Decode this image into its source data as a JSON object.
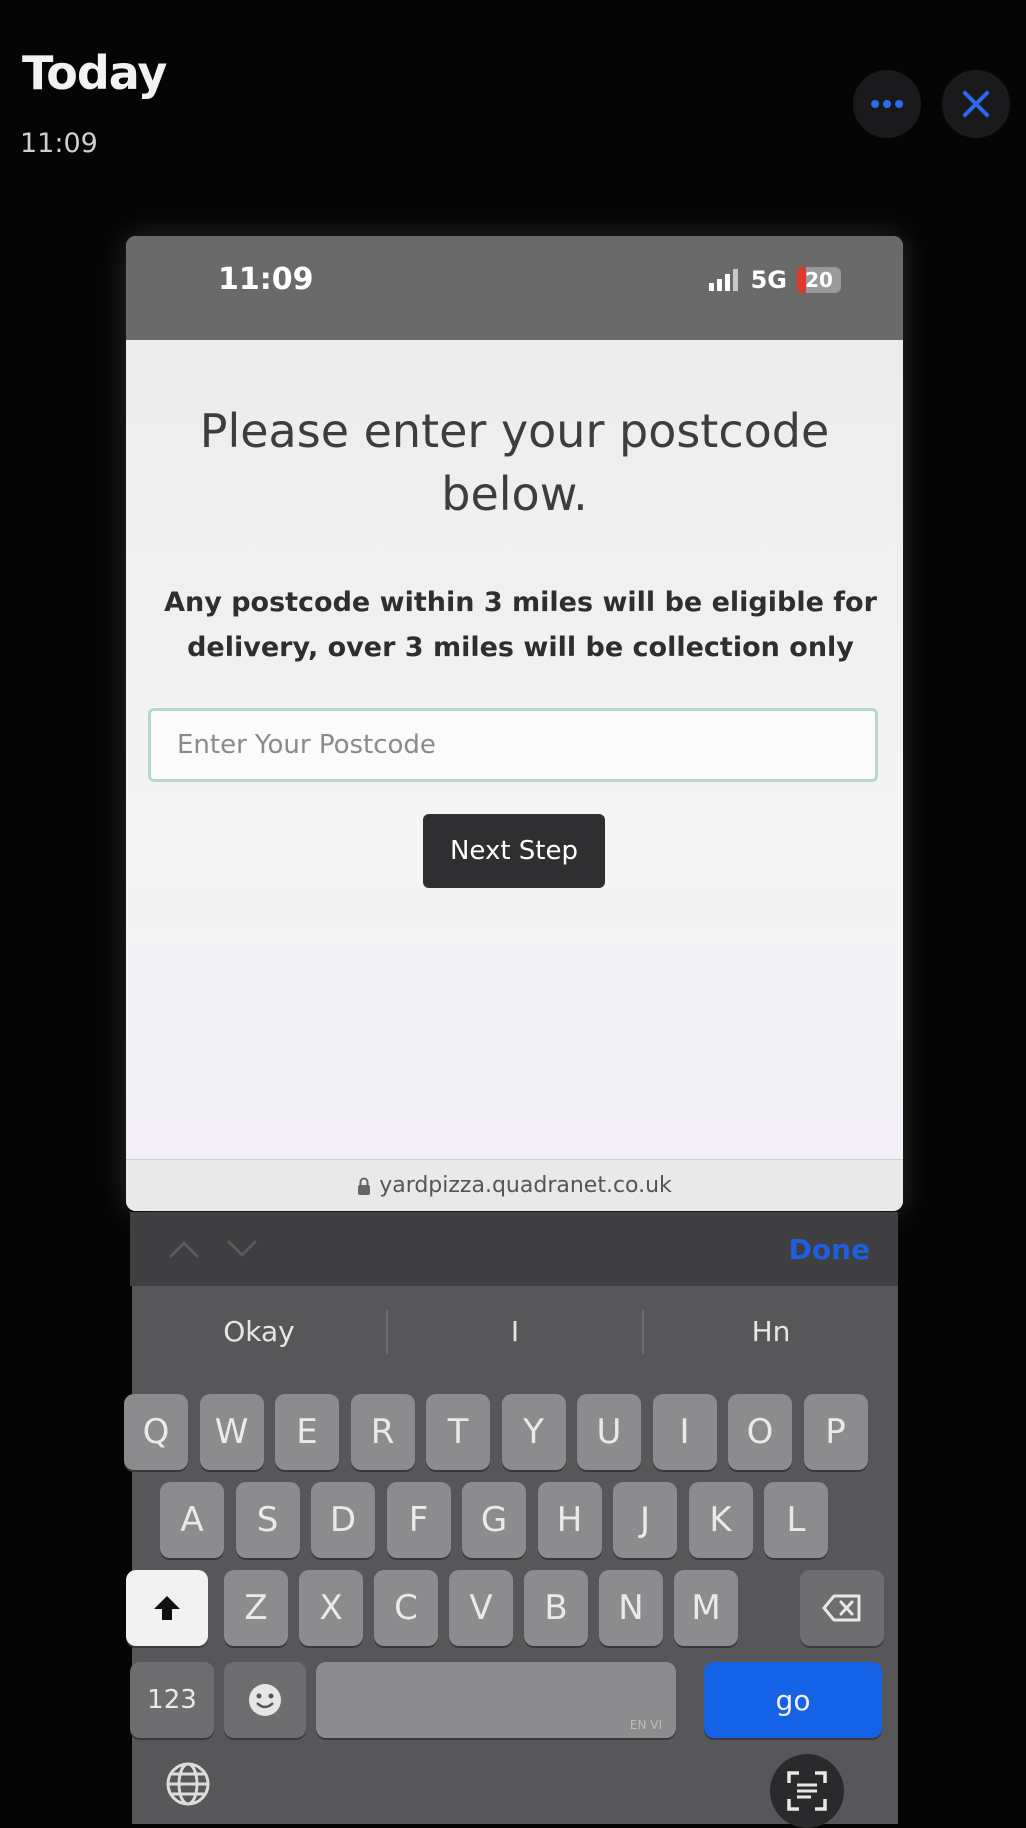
{
  "viewer": {
    "title": "Today",
    "time": "11:09",
    "more_icon": "ellipsis-icon",
    "close_icon": "close-icon"
  },
  "status_bar": {
    "time": "11:09",
    "network": "5G",
    "battery": "20",
    "battery_level": 0.2
  },
  "page": {
    "heading_line1": "Please enter your postcode",
    "heading_line2": "below.",
    "subtext_line1": "Any postcode within 3 miles will be eligible for",
    "subtext_line2": "delivery, over 3 miles will be collection only",
    "postcode_placeholder": "Enter Your Postcode",
    "postcode_value": "",
    "next_button": "Next Step",
    "url": "yardpizza.quadranet.co.uk"
  },
  "keyboard": {
    "done_label": "Done",
    "suggestions": [
      "Okay",
      "I",
      "Hn"
    ],
    "row1": [
      "Q",
      "W",
      "E",
      "R",
      "T",
      "Y",
      "U",
      "I",
      "O",
      "P"
    ],
    "row2": [
      "A",
      "S",
      "D",
      "F",
      "G",
      "H",
      "J",
      "K",
      "L"
    ],
    "row3": [
      "Z",
      "X",
      "C",
      "V",
      "B",
      "N",
      "M"
    ],
    "numbers_label": "123",
    "space_tag": "EN VI",
    "go_label": "go"
  },
  "colors": {
    "accent_blue": "#1562e6",
    "input_border": "#b8d7c8",
    "button_dark": "#2f2f31"
  }
}
